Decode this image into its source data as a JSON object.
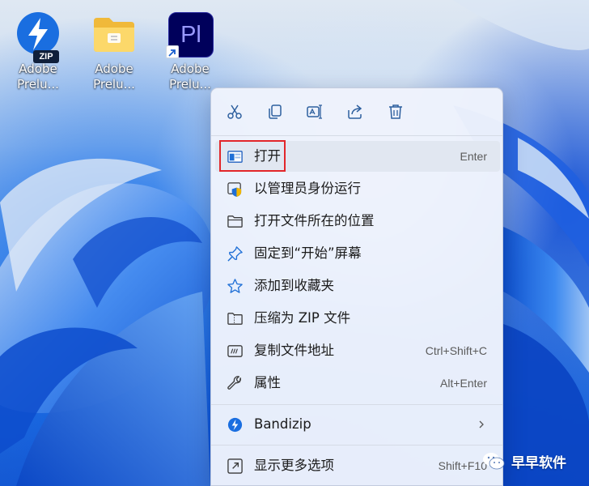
{
  "desktop": {
    "icons": [
      {
        "label": "Adobe Prelu...",
        "badge": "ZIP",
        "icon": "bandizip-archive-icon"
      },
      {
        "label": "Adobe Prelu...",
        "icon": "folder-icon"
      },
      {
        "label": "Adobe Prelu...",
        "tile_text": "Pl",
        "icon": "premiere-pro-shortcut-icon"
      }
    ]
  },
  "context_menu": {
    "toolbar": [
      {
        "name": "cut",
        "icon": "scissors-icon"
      },
      {
        "name": "copy",
        "icon": "copy-icon"
      },
      {
        "name": "rename",
        "icon": "rename-icon"
      },
      {
        "name": "share",
        "icon": "share-icon"
      },
      {
        "name": "delete",
        "icon": "trash-icon"
      }
    ],
    "items": [
      {
        "label": "打开",
        "shortcut": "Enter",
        "icon": "open-window-icon"
      },
      {
        "label": "以管理员身份运行",
        "shortcut": "",
        "icon": "shield-icon"
      },
      {
        "label": "打开文件所在的位置",
        "shortcut": "",
        "icon": "folder-outline-icon"
      },
      {
        "label": "固定到“开始”屏幕",
        "shortcut": "",
        "icon": "pin-icon"
      },
      {
        "label": "添加到收藏夹",
        "shortcut": "",
        "icon": "star-icon"
      },
      {
        "label": "压缩为 ZIP 文件",
        "shortcut": "",
        "icon": "zip-folder-icon"
      },
      {
        "label": "复制文件地址",
        "shortcut": "Ctrl+Shift+C",
        "icon": "copy-path-icon"
      },
      {
        "label": "属性",
        "shortcut": "Alt+Enter",
        "icon": "wrench-icon"
      },
      {
        "label": "Bandizip",
        "shortcut": "",
        "icon": "bandizip-icon"
      },
      {
        "label": "显示更多选项",
        "shortcut": "Shift+F10",
        "icon": "more-options-icon"
      }
    ],
    "highlighted_item": "打开"
  },
  "watermark": {
    "text": "早早软件",
    "icon": "wechat-logo-icon"
  },
  "colors": {
    "menu_background": "#eef3fc",
    "highlight_border": "#e2262a",
    "accent_blue": "#0067c0"
  }
}
